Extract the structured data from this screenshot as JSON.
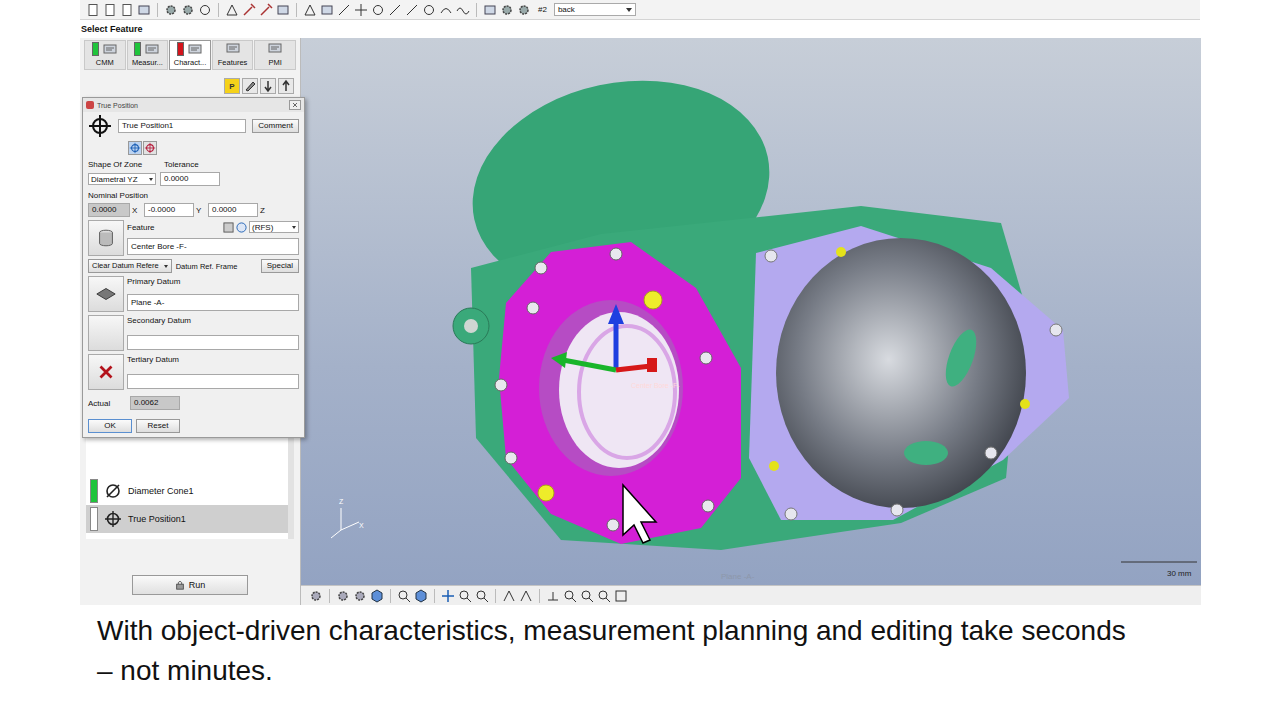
{
  "header": "Select Feature",
  "toolbar": {
    "view_number": "#2",
    "view_select": "back"
  },
  "tabs": [
    {
      "label": "CMM",
      "color": "#1fc43b",
      "selected": false
    },
    {
      "label": "Measur...",
      "color": "#1fc43b",
      "selected": false
    },
    {
      "label": "Charact...",
      "color": "#d4141c",
      "selected": true
    },
    {
      "label": "Features",
      "color": null,
      "selected": false
    },
    {
      "label": "PMI",
      "color": null,
      "selected": false
    }
  ],
  "sub_toolbar": {
    "p_button": "P"
  },
  "dialog": {
    "title": "True Position",
    "name": "True Position1",
    "comment_button": "Comment",
    "shape_label": "Shape Of Zone",
    "shape_value": "Diametral YZ",
    "tolerance_label": "Tolerance",
    "tolerance_value": "0.0000",
    "nominal_label": "Nominal Position",
    "nominal": [
      {
        "value": "0.0000",
        "axis": "X",
        "disabled": true
      },
      {
        "value": "-0.0000",
        "axis": "Y",
        "disabled": false
      },
      {
        "value": "0.0000",
        "axis": "Z",
        "disabled": false
      }
    ],
    "feature_label": "Feature",
    "feature_material": "(RFS)",
    "feature_value": "Center Bore -F-",
    "clear_datum": "Clear Datum Refere",
    "datum_ref_frame": "Datum Ref. Frame",
    "special_button": "Special",
    "datums": [
      {
        "label": "Primary Datum",
        "value": "Plane -A-",
        "kind": "plane"
      },
      {
        "label": "Secondary Datum",
        "value": "",
        "kind": "empty"
      },
      {
        "label": "Tertiary Datum",
        "value": "",
        "kind": "clear"
      }
    ],
    "actual_label": "Actual",
    "actual_value": "0.0062",
    "ok_button": "OK",
    "reset_button": "Reset"
  },
  "characteristics": [
    {
      "name": "Diameter Cone1",
      "kind": "diameter",
      "color": "#1fc43b",
      "selected": false
    },
    {
      "name": "True Position1",
      "kind": "position",
      "color": "#ffffff",
      "selected": true
    }
  ],
  "run_button": "Run",
  "viewport": {
    "feature_label": "Center Bore -F-",
    "plane_label": "Plane -A-",
    "scale": "30 mm",
    "axis_z": "Z",
    "axis_x": "X"
  },
  "caption": "With object-driven characteristics, measurement planning and editing take seconds – not minutes."
}
